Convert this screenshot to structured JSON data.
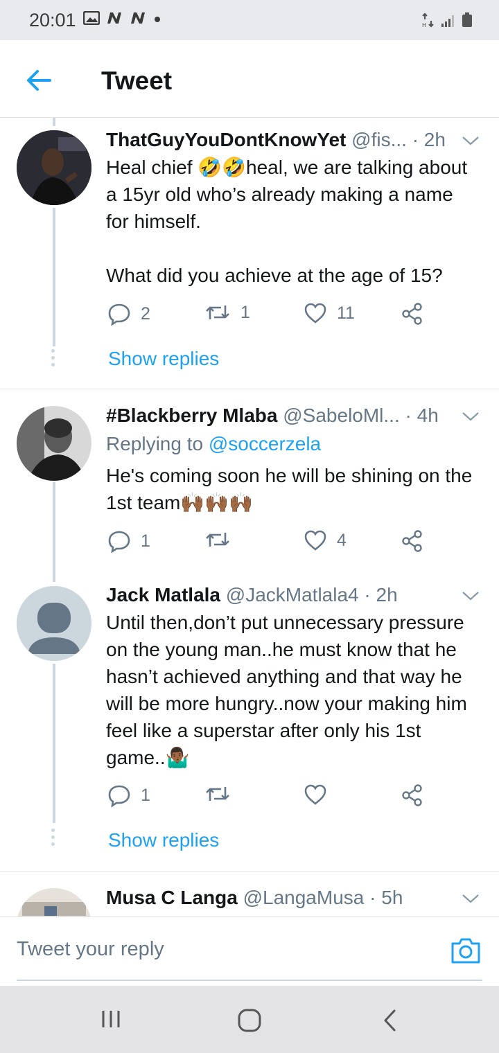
{
  "status_bar": {
    "time": "20:01",
    "left_icons": [
      "image-icon",
      "n-icon",
      "n-icon",
      "dot-icon"
    ],
    "right_icons": [
      "data-arrows-icon",
      "signal-icon",
      "battery-icon"
    ]
  },
  "header": {
    "back_icon": "arrow-left-icon",
    "title": "Tweet"
  },
  "tweets": [
    {
      "name": "ThatGuyYouDontKnowYet",
      "handle": "@fis...",
      "time": "· 2h",
      "replying_to": "",
      "body_lines": [
        "Heal chief 🤣🤣heal, we are talking about a 15yr old who’s already making a name for himself.",
        "",
        "What did you achieve at the age of 15?"
      ],
      "reply_count": "2",
      "retweet_count": "1",
      "like_count": "11",
      "show_replies": "Show replies"
    },
    {
      "name": "#Blackberry Mlaba",
      "handle": "@SabeloMl...",
      "time": "· 4h",
      "replying_to_prefix": "Replying to",
      "replying_to": "@soccerzela",
      "body_lines": [
        "He's coming soon he will be shining on the 1st team🙌🏾🙌🏾🙌🏾"
      ],
      "reply_count": "1",
      "retweet_count": "",
      "like_count": "4"
    },
    {
      "name": "Jack Matlala",
      "handle": "@JackMatlala4",
      "time": "· 2h",
      "body_lines": [
        "Until then,don’t put unnecessary pressure on the young man..he must know that he hasn’t achieved anything and that way he will be more hungry..now your making him feel like a superstar after only  his 1st game..🤷🏾‍♂️"
      ],
      "reply_count": "1",
      "retweet_count": "",
      "like_count": "",
      "show_replies": "Show replies"
    },
    {
      "name": "Musa C Langa",
      "handle": "@LangaMusa",
      "time": "· 5h"
    }
  ],
  "reply_bar": {
    "placeholder": "Tweet your reply",
    "camera_icon": "camera-icon"
  },
  "nav_bar": {
    "icons": [
      "recent-apps-icon",
      "home-icon",
      "back-icon"
    ]
  },
  "colors": {
    "accent": "#1da1f2",
    "text": "#14171a",
    "muted": "#657786",
    "divider": "#dfe3e6"
  }
}
